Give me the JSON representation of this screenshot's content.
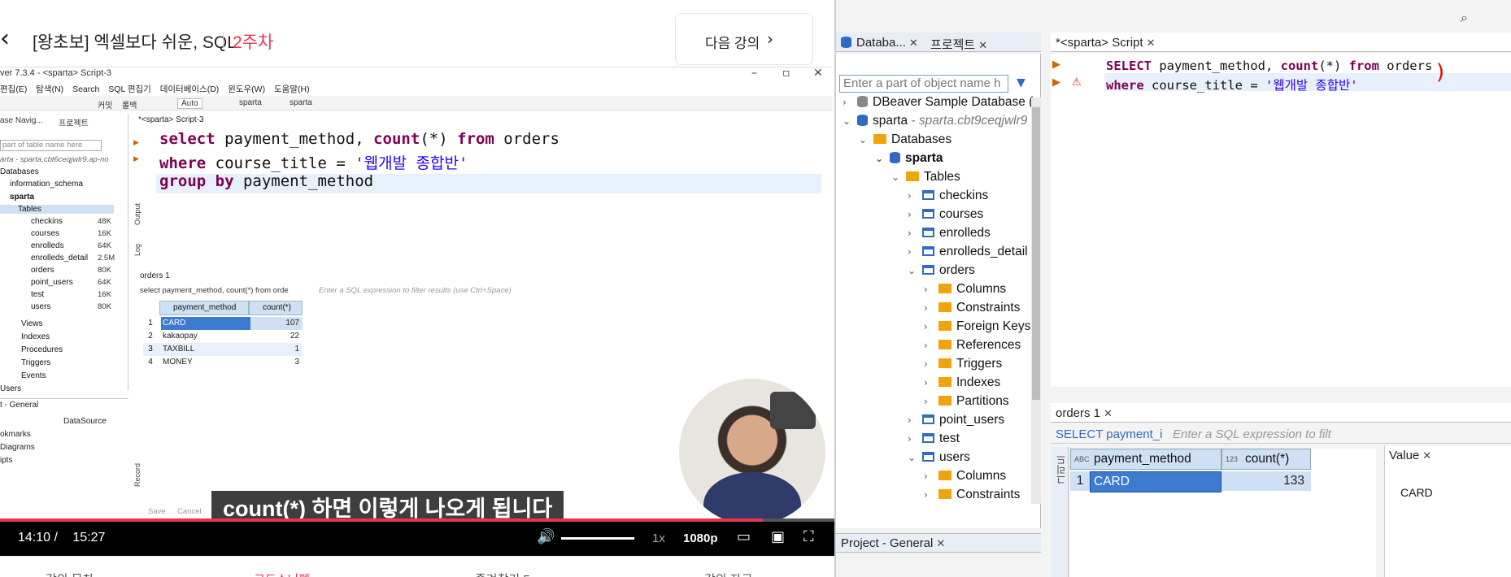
{
  "lecture": {
    "back_icon": "chevron-left-icon",
    "title": "[왕초보] 엑셀보다 쉬운, SQL",
    "week": "2주차",
    "next_label": "다음 강의",
    "next_icon": "chevron-right-icon"
  },
  "dbeaver_small": {
    "window_title": "ver 7.3.4 - <sparta> Script-3",
    "menu": [
      "편집(E)",
      "탐색(N)",
      "Search",
      "SQL 편집기",
      "데이터베이스(D)",
      "윈도우(W)",
      "도움말(H)"
    ],
    "toolbar": {
      "auto": "Auto",
      "conn1": "sparta",
      "conn2": "sparta",
      "commit": "커밋",
      "rollback": "롤백"
    },
    "nav_tabs": [
      "ase Navig...",
      "프로젝트"
    ],
    "nav_filter_placeholder": "part of table name here",
    "connection": "arta - sparta.cbt6ceqjwlr9.ap-no",
    "tree_top": [
      "Databases",
      "information_schema",
      "sparta",
      "Tables"
    ],
    "tables": [
      {
        "name": "checkins",
        "size": "48K"
      },
      {
        "name": "courses",
        "size": "16K"
      },
      {
        "name": "enrolleds",
        "size": "64K"
      },
      {
        "name": "enrolleds_detail",
        "size": "2.5M"
      },
      {
        "name": "orders",
        "size": "80K"
      },
      {
        "name": "point_users",
        "size": "64K"
      },
      {
        "name": "test",
        "size": "16K"
      },
      {
        "name": "users",
        "size": "80K"
      }
    ],
    "tree_bottom": [
      "Views",
      "Indexes",
      "Procedures",
      "Triggers",
      "Events",
      "Users"
    ],
    "editor_tab": "*<sparta> Script-3",
    "code": {
      "l1_kw1": "select",
      "l1_a": " payment_method, ",
      "l1_kw2": "count",
      "l1_b": "(*) ",
      "l1_kw3": "from",
      "l1_c": " orders",
      "l2_kw1": "where",
      "l2_a": " course_title = ",
      "l2_str": "'웹개발 종합반'",
      "l3_kw1": "group by",
      "l3_a": " payment_method"
    },
    "side_labels": [
      "Output",
      "Log"
    ],
    "result_tab": "orders 1",
    "result_query": "select payment_method, count(*) from orde",
    "result_filter_placeholder": "Enter a SQL expression to filter results (use Ctrl+Space)",
    "columns": [
      "payment_method",
      "count(*)"
    ],
    "rows": [
      {
        "n": "1",
        "method": "CARD",
        "count": "107"
      },
      {
        "n": "2",
        "method": "kakaopay",
        "count": "22"
      },
      {
        "n": "3",
        "method": "TAXBILL",
        "count": "1"
      },
      {
        "n": "4",
        "method": "MONEY",
        "count": "3"
      }
    ],
    "record_label": "Record",
    "general_panel": {
      "tab": "t - General",
      "datasource": "DataSource",
      "items": [
        "okmarks",
        "Diagrams",
        "ipts"
      ]
    },
    "footer_buttons": [
      "Save",
      "Cancel"
    ]
  },
  "video": {
    "subtitle": "count(*) 하면 이렇게 나오게 됩니다",
    "current_time": "14:10 /",
    "total_time": "15:27",
    "progress": 0.914,
    "speed": "1x",
    "quality": "1080p",
    "bottom_tabs": [
      "강의 목차",
      "코드스니펫",
      "즐겨찾기 5",
      "강의 자료"
    ]
  },
  "dbeaver_main": {
    "nav_tabs": [
      "Databa...",
      "프로젝트"
    ],
    "filter_placeholder": "Enter a part of object name h",
    "tree": {
      "sample_db": "DBeaver Sample Database (",
      "connection": "sparta",
      "connection_host": "- sparta.cbt9ceqjwlr9",
      "databases": "Databases",
      "db": "sparta",
      "tables_folder": "Tables",
      "tables_before": [
        "checkins",
        "courses",
        "enrolleds",
        "enrolleds_detail"
      ],
      "orders": "orders",
      "orders_children": [
        "Columns",
        "Constraints",
        "Foreign Keys",
        "References",
        "Triggers",
        "Indexes",
        "Partitions"
      ],
      "tables_after": [
        "point_users",
        "test"
      ],
      "users": "users",
      "users_children": [
        "Columns",
        "Constraints"
      ]
    },
    "project_tab": "Project - General",
    "editor_tab": "*<sparta> Script",
    "code": {
      "l1_kw1": "SELECT",
      "l1_a": " payment_method, ",
      "l1_kw2": "count",
      "l1_b": "(*) ",
      "l1_kw3": "from",
      "l1_c": " orders",
      "l2_kw1": "where",
      "l2_a": " course_title = ",
      "l2_str": "'웹개발 종합반'"
    },
    "result_tab": "orders 1",
    "result_query": "SELECT payment_i",
    "result_filter_placeholder": "Enter a SQL expression to filt",
    "columns": [
      "payment_method",
      "count(*)"
    ],
    "col_type_1": "ABC",
    "col_type_2": "123",
    "rows": [
      {
        "n": "1",
        "method": "CARD",
        "count": "133"
      }
    ],
    "value_tab": "Value",
    "value": "CARD",
    "grid_side_labels": [
      "그리드",
      "텍스트"
    ]
  },
  "colors": {
    "keyword": "#7f0055",
    "string": "#2a00ff",
    "accent": "#e8344e",
    "selection": "#3d7bd1"
  }
}
